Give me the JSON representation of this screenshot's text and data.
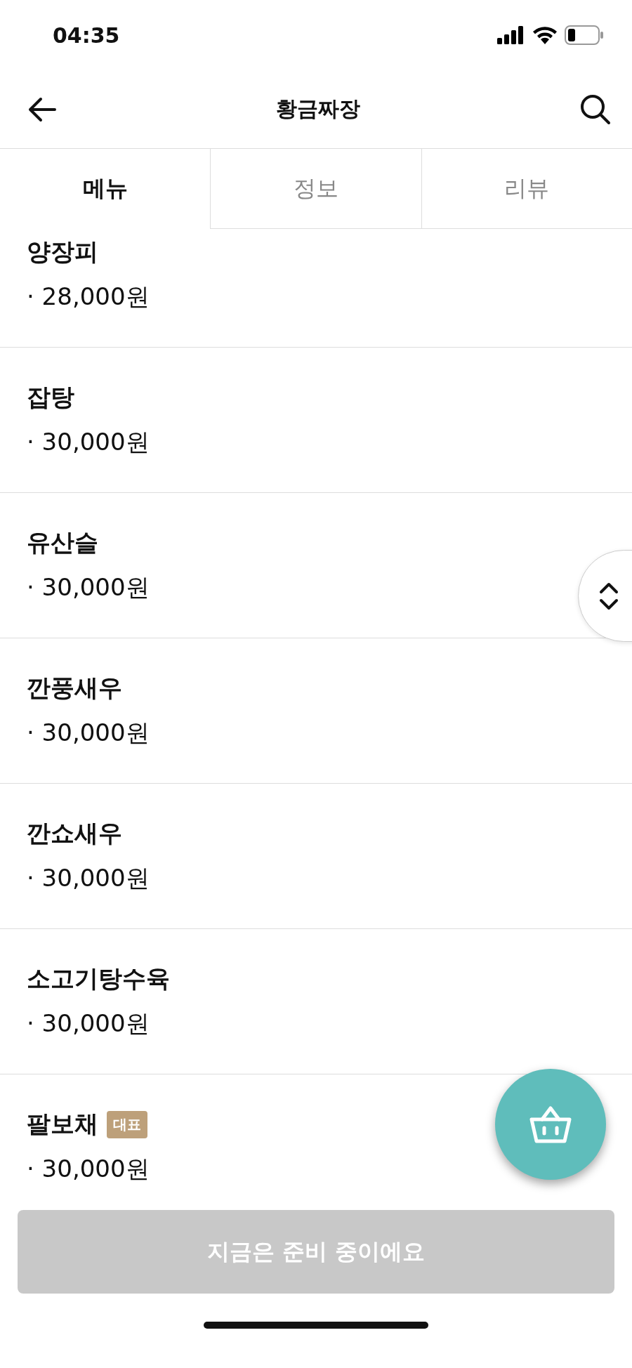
{
  "status_bar": {
    "time": "04:35"
  },
  "header": {
    "title": "황금짜장"
  },
  "tabs": [
    {
      "label": "메뉴",
      "selected": true
    },
    {
      "label": "정보",
      "selected": false
    },
    {
      "label": "리뷰",
      "selected": false
    }
  ],
  "menu_items": [
    {
      "name": "양장피",
      "price": "· 28,000원"
    },
    {
      "name": "잡탕",
      "price": "· 30,000원"
    },
    {
      "name": "유산슬",
      "price": "· 30,000원"
    },
    {
      "name": "깐풍새우",
      "price": "· 30,000원"
    },
    {
      "name": "깐쇼새우",
      "price": "· 30,000원"
    },
    {
      "name": "소고기탕수육",
      "price": "· 30,000원"
    },
    {
      "name": "팔보채",
      "badge": "대표",
      "price": "· 30,000원"
    }
  ],
  "order_button": {
    "label": "지금은 준비 중이에요",
    "disabled": true
  }
}
